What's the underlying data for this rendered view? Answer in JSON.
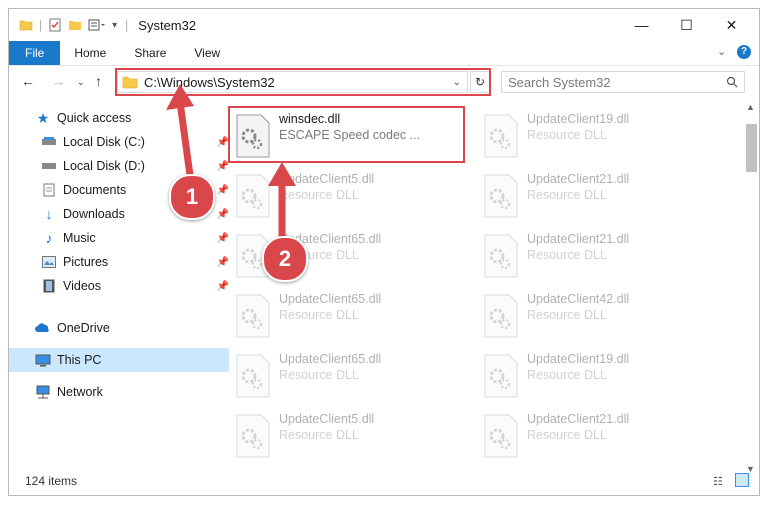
{
  "window": {
    "title": "System32"
  },
  "ribbon": {
    "tabs": [
      "File",
      "Home",
      "Share",
      "View"
    ]
  },
  "address": {
    "path": "C:\\Windows\\System32"
  },
  "search": {
    "placeholder": "Search System32"
  },
  "sidebar": {
    "items": [
      {
        "label": "Quick access",
        "icon": "star-icon"
      },
      {
        "label": "Local Disk (C:)",
        "icon": "drive-icon"
      },
      {
        "label": "Local Disk (D:)",
        "icon": "drive-icon"
      },
      {
        "label": "Documents",
        "icon": "documents-icon"
      },
      {
        "label": "Downloads",
        "icon": "downloads-icon"
      },
      {
        "label": "Music",
        "icon": "music-icon"
      },
      {
        "label": "Pictures",
        "icon": "pictures-icon"
      },
      {
        "label": "Videos",
        "icon": "videos-icon"
      },
      {
        "label": "OneDrive",
        "icon": "cloud-icon"
      },
      {
        "label": "This PC",
        "icon": "computer-icon"
      },
      {
        "label": "Network",
        "icon": "network-icon"
      }
    ]
  },
  "files": [
    {
      "name": "winsdec.dll",
      "desc": "ESCAPE Speed codec ..."
    },
    {
      "name": "UpdateClient19.dll",
      "desc": "Resource DLL"
    },
    {
      "name": "UpdateClient5.dll",
      "desc": "Resource DLL"
    },
    {
      "name": "UpdateClient21.dll",
      "desc": "Resource DLL"
    },
    {
      "name": "UpdateClient65.dll",
      "desc": "Resource DLL"
    },
    {
      "name": "UpdateClient21.dll",
      "desc": "Resource DLL"
    },
    {
      "name": "UpdateClient65.dll",
      "desc": "Resource DLL"
    },
    {
      "name": "UpdateClient42.dll",
      "desc": "Resource DLL"
    },
    {
      "name": "UpdateClient65.dll",
      "desc": "Resource DLL"
    },
    {
      "name": "UpdateClient19.dll",
      "desc": "Resource DLL"
    },
    {
      "name": "UpdateClient5.dll",
      "desc": "Resource DLL"
    },
    {
      "name": "UpdateClient21.dll",
      "desc": "Resource DLL"
    }
  ],
  "status": {
    "count": "124 items"
  },
  "callouts": [
    "1",
    "2"
  ],
  "colors": {
    "accent": "#1979ca",
    "highlight": "#d9474b",
    "selected": "#cce8ff"
  }
}
